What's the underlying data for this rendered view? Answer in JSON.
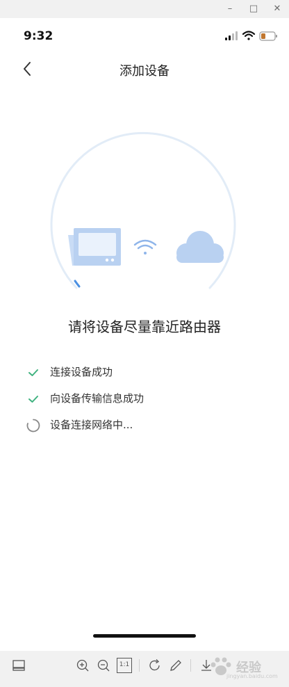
{
  "window_controls": {
    "minimize": "–",
    "maximize": "□",
    "close": "✕"
  },
  "status_bar": {
    "time": "9:32",
    "icons": [
      "cellular-signal-icon",
      "wifi-icon",
      "battery-icon"
    ],
    "battery_color": "#c0762f"
  },
  "nav": {
    "title": "添加设备",
    "back_icon": "chevron-left-icon"
  },
  "illustration": {
    "icons": [
      "tablet-device-icon",
      "wifi-signal-icon",
      "cloud-icon"
    ],
    "ring_color": "#e2ecf7",
    "progress_color": "#4a90e2",
    "icon_color": "#b9d1f1"
  },
  "headline": "请将设备尽量靠近路由器",
  "steps": [
    {
      "label": "连接设备成功",
      "status": "done",
      "icon": "check-icon"
    },
    {
      "label": "向设备传输信息成功",
      "status": "done",
      "icon": "check-icon"
    },
    {
      "label": "设备连接网络中...",
      "status": "loading",
      "icon": "loading-spinner-icon"
    }
  ],
  "colors": {
    "check": "#3fb27f",
    "spinner": "#888888"
  },
  "viewer_toolbar": {
    "icons": [
      "panel-layout-icon",
      "zoom-in-icon",
      "zoom-out-icon",
      "actual-size-icon",
      "rotate-icon",
      "pen-icon",
      "download-icon"
    ],
    "actual_size_label": "1:1"
  },
  "watermark": {
    "text": "经验",
    "sub": "jingyan.baidu.com"
  }
}
